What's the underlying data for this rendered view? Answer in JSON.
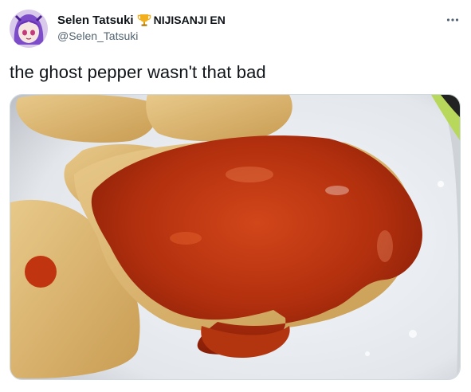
{
  "author": {
    "display_name": "Selen Tatsuki",
    "badge_icon": "trophy-icon",
    "affiliation": "NIJISANJI EN",
    "handle": "@Selen_Tatsuki",
    "avatar_icon": "avatar-purple-hair"
  },
  "tweet": {
    "text": "the ghost pepper wasn't that bad",
    "more_icon": "more-horizontal-icon"
  },
  "media": {
    "description_icon": "food-photo-chicken-nuggets-with-red-sauce"
  },
  "colors": {
    "text_primary": "#0f1419",
    "text_secondary": "#536471",
    "border": "#cfd9de"
  }
}
